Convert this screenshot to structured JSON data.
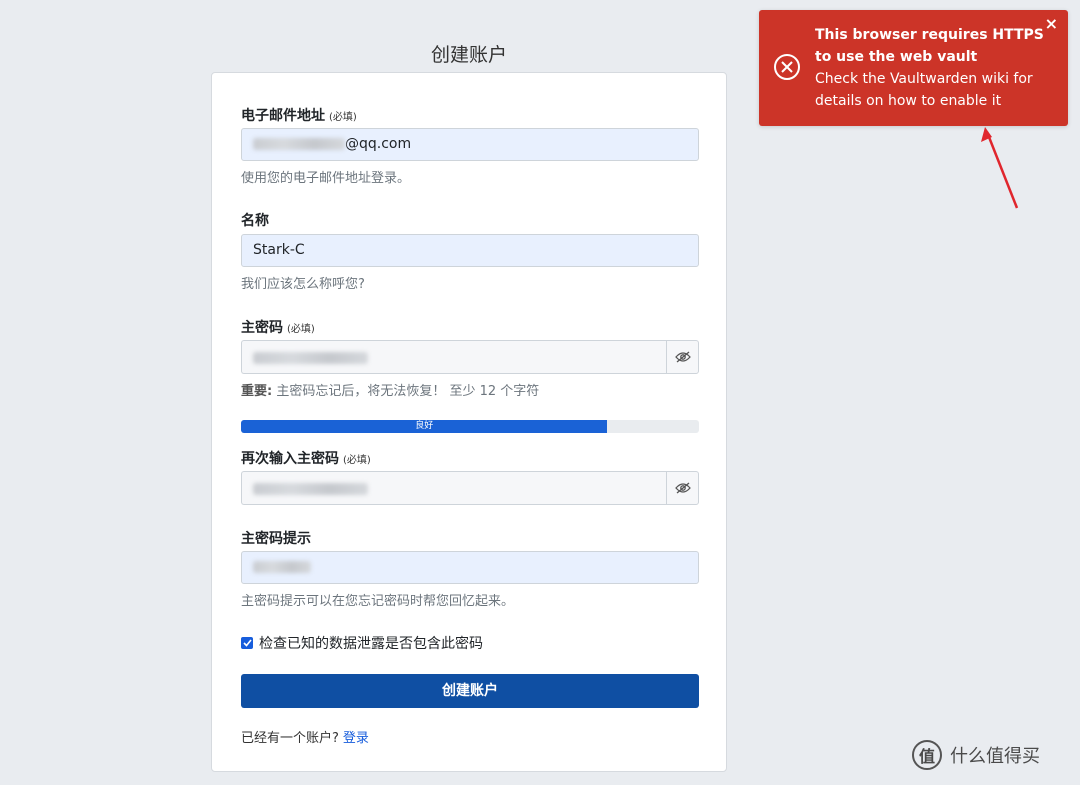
{
  "page": {
    "title": "创建账户"
  },
  "form": {
    "email": {
      "label": "电子邮件地址",
      "required_tag": "(必填)",
      "value_visible": "@qq.com",
      "help": "使用您的电子邮件地址登录。"
    },
    "name": {
      "label": "名称",
      "value": "Stark-C",
      "help": "我们应该怎么称呼您?"
    },
    "master_password": {
      "label": "主密码",
      "required_tag": "(必填)",
      "help_bold": "重要:",
      "help": "主密码忘记后，将无法恢复！ 至少 12 个字符"
    },
    "strength": {
      "label": "良好",
      "percent": 80,
      "color": "#1a62d6"
    },
    "retype_password": {
      "label": "再次输入主密码",
      "required_tag": "(必填)"
    },
    "hint": {
      "label": "主密码提示",
      "help": "主密码提示可以在您忘记密码时帮您回忆起来。"
    },
    "breach_check": {
      "label": "检查已知的数据泄露是否包含此密码",
      "checked": true
    },
    "submit_label": "创建账户",
    "login_prompt": "已经有一个账户?",
    "login_link": "登录"
  },
  "toast": {
    "title": "This browser requires HTTPS to use the web vault",
    "body": "Check the Vaultwarden wiki for details on how to enable it",
    "close": "×",
    "color": "#cc3428"
  },
  "watermark": {
    "text": "什么值得买",
    "logo": "值"
  },
  "colors": {
    "primary": "#175ddc",
    "submit": "#0f4fa3",
    "annotation_arrow": "#e0262d"
  }
}
